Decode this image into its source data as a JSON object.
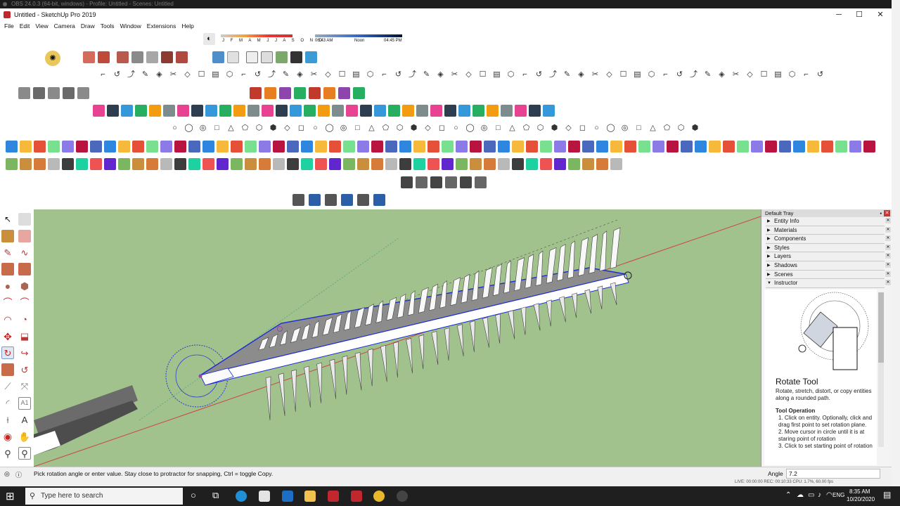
{
  "obs": {
    "title": "OBS 24.0.3 (64-bit, windows) - Profile: Untitled - Scenes: Untitled"
  },
  "window": {
    "title": "Untitled - SketchUp Pro 2019",
    "min": "─",
    "max": "☐",
    "close": "✕"
  },
  "menu": [
    "File",
    "Edit",
    "View",
    "Camera",
    "Draw",
    "Tools",
    "Window",
    "Extensions",
    "Help"
  ],
  "shadow": {
    "months": "J F M A M J J A S O N D",
    "time_start": "06:43 AM",
    "noon": "Noon",
    "time_end": "04:45 PM"
  },
  "tray": {
    "title": "Default Tray",
    "panels": [
      "Entity Info",
      "Materials",
      "Components",
      "Styles",
      "Layers",
      "Shadows",
      "Scenes"
    ],
    "instructor_label": "Instructor",
    "tool_title": "Rotate Tool",
    "tool_desc": "Rotate, stretch, distort, or copy entities along a rounded path.",
    "op_title": "Tool Operation",
    "steps": [
      "1. Click on entity. Optionally, click and drag first point to set rotation plane.",
      "2. Move cursor in circle until it is at staring point of rotation",
      "3. Click to set starting point of rotation"
    ]
  },
  "status": {
    "message": "Pick rotation angle or enter value.  Stay close to protractor for snapping, Ctrl = toggle Copy.",
    "measure_label": "Angle",
    "measure_value": "7.2",
    "obs_stats": "LIVE: 00:00:00    REC: 00:10:33    CPU: 1.7%, 60.00 fps"
  },
  "taskbar": {
    "search_placeholder": "Type here to search",
    "lang": "ENG",
    "time": "8:35 AM",
    "date": "10/20/2020"
  },
  "colors": {
    "sky": "#ffffff",
    "ground": "#a1c18d",
    "selection": "#1b2bd6"
  }
}
